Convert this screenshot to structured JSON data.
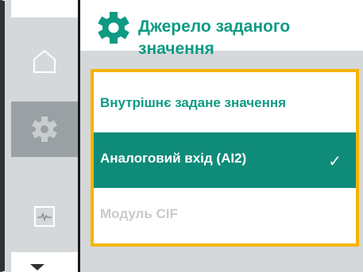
{
  "header": {
    "title": "Джерело заданого значення",
    "icon": "gear-icon"
  },
  "nav": [
    {
      "icon": "home-icon",
      "active": false
    },
    {
      "icon": "gear-icon",
      "active": true
    },
    {
      "icon": "pulse-monitor-icon",
      "active": false
    }
  ],
  "options": [
    {
      "label": "Внутрішнє задане значення",
      "selected": false,
      "enabled": true
    },
    {
      "label": "Аналоговий вхід (AI2)",
      "selected": true,
      "enabled": true
    },
    {
      "label": "Модуль CIF",
      "selected": false,
      "enabled": false
    }
  ],
  "selection_mark": "✓",
  "colors": {
    "accent": "#0f9a84",
    "highlight": "#0f8b79",
    "focus_border": "#f5b400",
    "rail": "#d5d8da",
    "bezel": "#2f3234",
    "disabled_text": "#c7cbcd"
  }
}
